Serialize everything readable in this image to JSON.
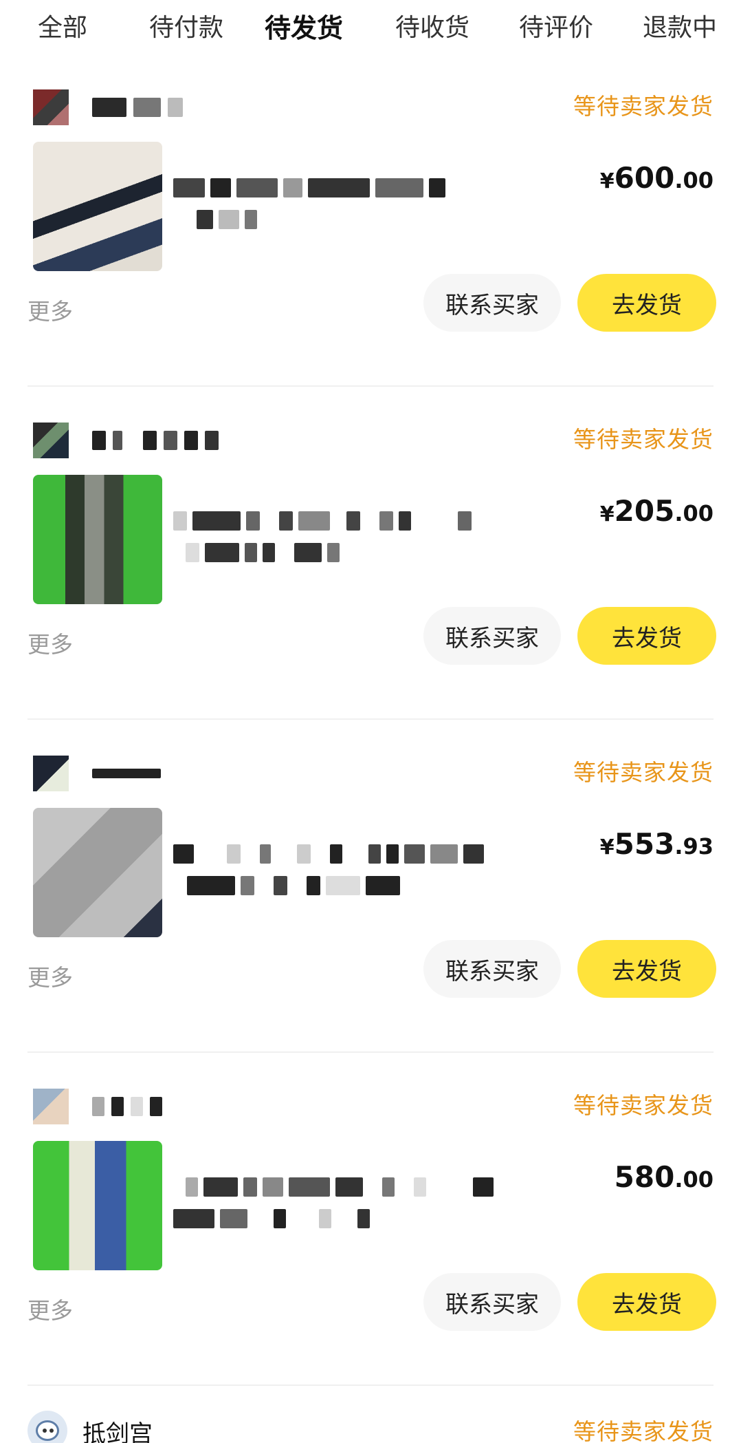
{
  "tabs": [
    {
      "label": "全部",
      "active": false
    },
    {
      "label": "待付款",
      "active": false
    },
    {
      "label": "待发货",
      "active": true
    },
    {
      "label": "待收货",
      "active": false
    },
    {
      "label": "待评价",
      "active": false
    },
    {
      "label": "退款中",
      "active": false
    }
  ],
  "orders": [
    {
      "status": "等待卖家发货",
      "price_currency": "¥",
      "price_int": "600",
      "price_dec": ".00",
      "more_label": "更多",
      "contact_label": "联系买家",
      "ship_label": "去发货",
      "thumb_color": "#e9e4dc"
    },
    {
      "status": "等待卖家发货",
      "price_currency": "¥",
      "price_int": "205",
      "price_dec": ".00",
      "more_label": "更多",
      "contact_label": "联系买家",
      "ship_label": "去发货",
      "thumb_color": "#3fb83a"
    },
    {
      "status": "等待卖家发货",
      "price_currency": "¥",
      "price_int": "553",
      "price_dec": ".93",
      "more_label": "更多",
      "contact_label": "联系买家",
      "ship_label": "去发货",
      "thumb_color": "#b9b9b9"
    },
    {
      "status": "等待卖家发货",
      "price_currency": "",
      "price_int": "580",
      "price_dec": ".00",
      "more_label": "更多",
      "contact_label": "联系买家",
      "ship_label": "去发货",
      "thumb_color": "#43c43a"
    }
  ],
  "partial_order": {
    "seller_name": "抵剑宫",
    "status": "等待卖家发货"
  },
  "colors": {
    "accent_yellow": "#ffe33b",
    "status_orange": "#e8951a",
    "muted_gray": "#9a9a9a"
  }
}
